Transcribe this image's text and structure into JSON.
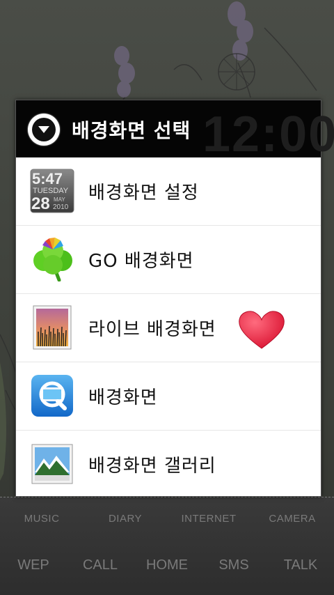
{
  "dialog": {
    "title": "배경화면 선택",
    "clock_background": "12:00",
    "items": [
      {
        "label": "배경화면 설정",
        "icon": "clock-widget-icon"
      },
      {
        "label": "GO 배경화면",
        "icon": "clover-icon"
      },
      {
        "label": "라이브 배경화면",
        "icon": "live-wallpaper-icon",
        "badge": "heart-icon"
      },
      {
        "label": "배경화면",
        "icon": "wallpaper-app-icon"
      },
      {
        "label": "배경화면 갤러리",
        "icon": "gallery-icon"
      }
    ]
  },
  "clock_icon": {
    "time": "5:47",
    "day": "TUESDAY",
    "date": "28",
    "month": "MAY",
    "year": "2010"
  },
  "dock": {
    "row1": [
      "MUSIC",
      "DIARY",
      "INTERNET",
      "CAMERA"
    ],
    "row2": [
      "WEP",
      "CALL",
      "HOME",
      "SMS",
      "TALK"
    ]
  },
  "colors": {
    "header_bg": "#050505",
    "dialog_bg": "#ffffff",
    "heart": "#e8203c",
    "dock_text": "#7a7a7a"
  }
}
